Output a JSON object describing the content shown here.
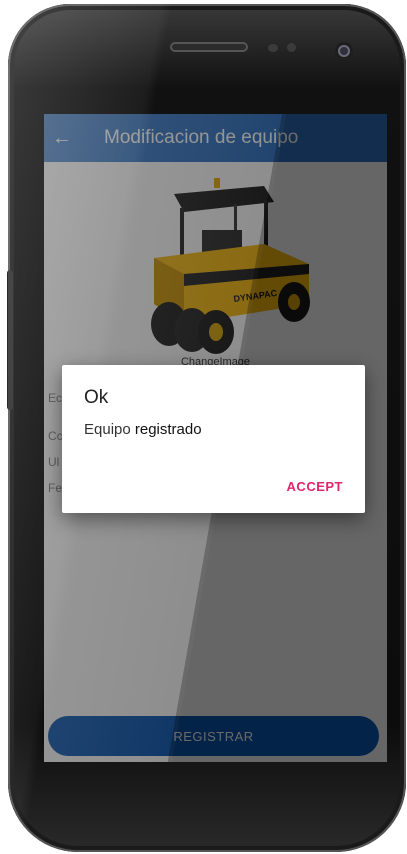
{
  "app_bar": {
    "title": "Modificacion de equipo",
    "back_icon": "arrow-left-icon"
  },
  "equipment": {
    "change_image_label": "ChangeImage",
    "image_brand_text": "DYNAPAC"
  },
  "form": {
    "labels": [
      "Ec",
      "Cc",
      "Ul",
      "Fe"
    ]
  },
  "primary_button": {
    "label": "REGISTRAR"
  },
  "dialog": {
    "title": "Ok",
    "message_part1": "Equipo ",
    "message_part2": "registrado",
    "accept_label": "ACCEPT"
  },
  "colors": {
    "app_bar": "#2d6fbf",
    "primary_button": "#0b57b0",
    "accent": "#e3246e"
  }
}
